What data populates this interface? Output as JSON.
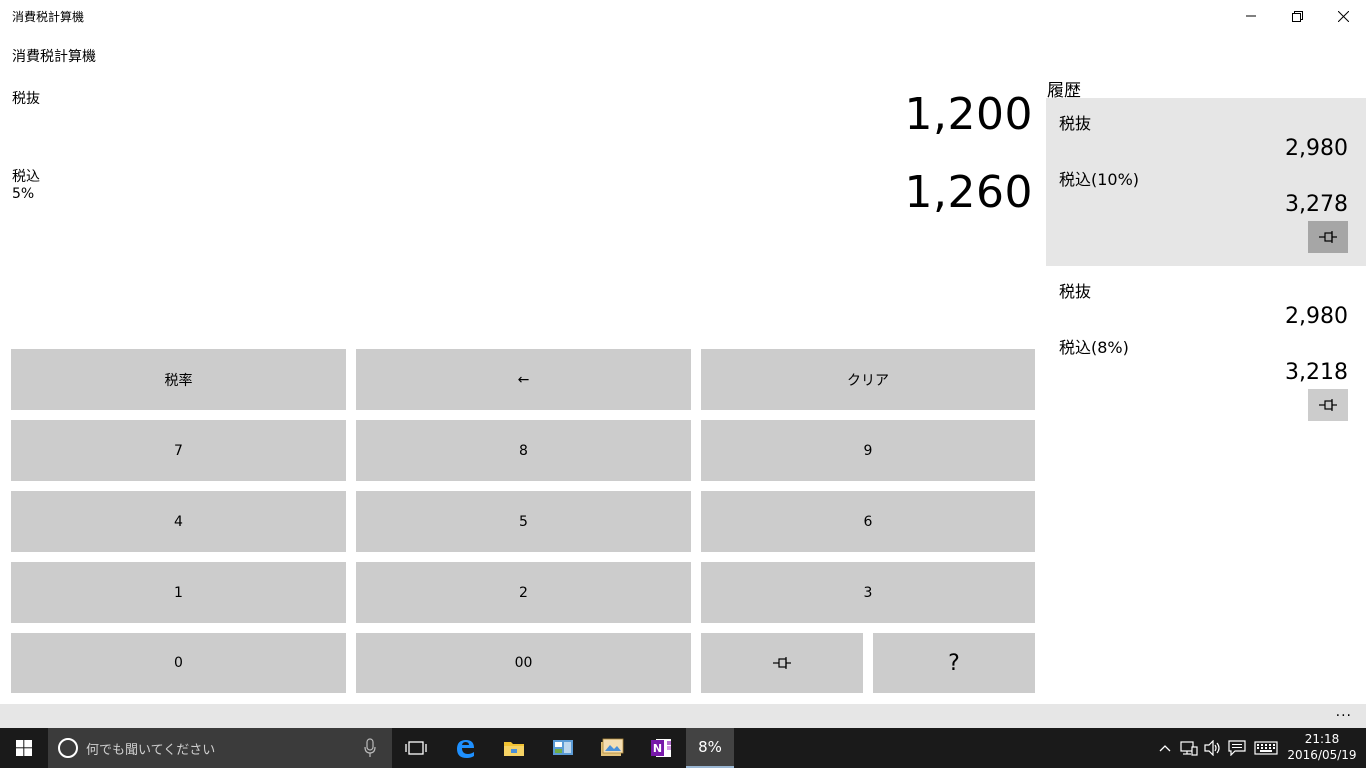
{
  "window": {
    "title": "消費税計算機"
  },
  "app": {
    "title": "消費税計算機",
    "excl_label": "税抜",
    "excl_value": "1,200",
    "incl_label": "税込",
    "incl_value": "1,260",
    "rate_label": "5%"
  },
  "keypad": {
    "rate": "税率",
    "back": "←",
    "clear": "クリア",
    "k7": "7",
    "k8": "8",
    "k9": "9",
    "k4": "4",
    "k5": "5",
    "k6": "6",
    "k1": "1",
    "k2": "2",
    "k3": "3",
    "k0": "0",
    "k00": "00",
    "help": "?"
  },
  "history": {
    "title": "履歴",
    "items": [
      {
        "excl_label": "税抜",
        "excl_value": "2,980",
        "incl_label": "税込(10%)",
        "incl_value": "3,278",
        "selected": true
      },
      {
        "excl_label": "税抜",
        "excl_value": "2,980",
        "incl_label": "税込(8%)",
        "incl_value": "3,218",
        "selected": false
      }
    ]
  },
  "appbar": {
    "more": "..."
  },
  "taskbar": {
    "search_placeholder": "何でも聞いてください",
    "active_app_label": "8%",
    "time": "21:18",
    "date": "2016/05/19"
  }
}
